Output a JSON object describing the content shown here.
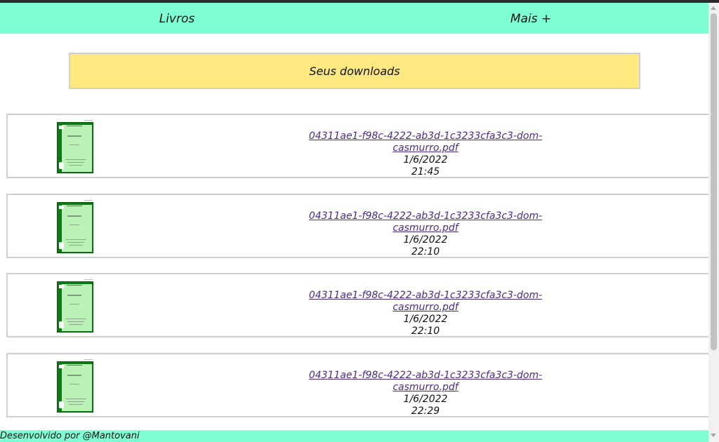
{
  "nav": {
    "livros": "Livros",
    "mais": "Mais +"
  },
  "banner": {
    "title": "Seus downloads"
  },
  "downloads": [
    {
      "file": "04311ae1-f98c-4222-ab3d-1c3233cfa3c3-dom-casmurro.pdf",
      "date": "1/6/2022",
      "time": "21:45"
    },
    {
      "file": "04311ae1-f98c-4222-ab3d-1c3233cfa3c3-dom-casmurro.pdf",
      "date": "1/6/2022",
      "time": "22:10"
    },
    {
      "file": "04311ae1-f98c-4222-ab3d-1c3233cfa3c3-dom-casmurro.pdf",
      "date": "1/6/2022",
      "time": "22:10"
    },
    {
      "file": "04311ae1-f98c-4222-ab3d-1c3233cfa3c3-dom-casmurro.pdf",
      "date": "1/6/2022",
      "time": "22:29"
    }
  ],
  "footer": {
    "credit": "Desenvolvido por @Mantovani"
  },
  "colors": {
    "nav_bg": "#7fffd4",
    "banner_bg": "#ffe880",
    "cover_green": "#0c7a14",
    "link": "#4b2a8a"
  },
  "icons": {
    "thumbnail": "book-cover-thumbnail"
  }
}
